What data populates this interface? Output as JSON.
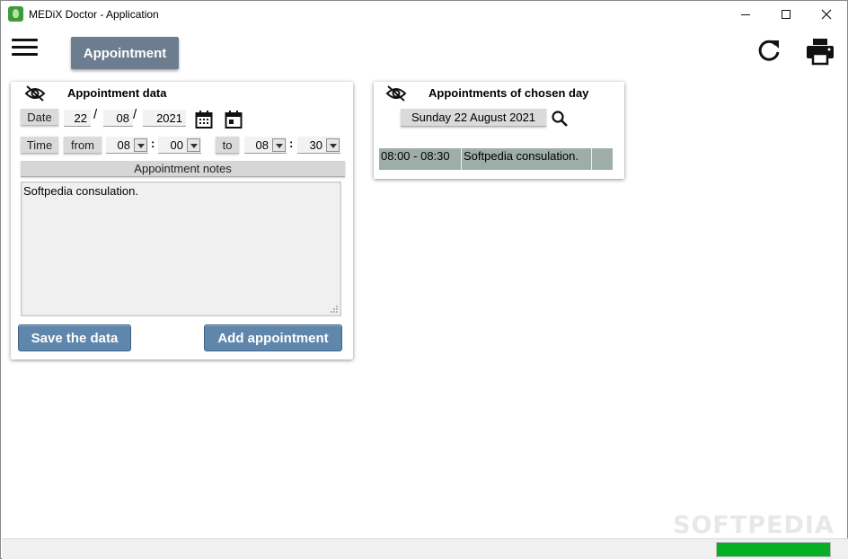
{
  "window": {
    "title": "MEDiX Doctor - Application"
  },
  "toolbar": {
    "tab_label": "Appointment"
  },
  "appointment_data": {
    "title": "Appointment data",
    "date_label": "Date",
    "day": "22",
    "month": "08",
    "year": "2021",
    "date_sep": "/",
    "time_label": "Time",
    "from_label": "from",
    "from_hour": "08",
    "from_minute": "00",
    "time_sep": ":",
    "to_label": "to",
    "to_hour": "08",
    "to_minute": "30",
    "notes_header": "Appointment notes",
    "notes_value": "Softpedia consulation.",
    "save_label": "Save the data",
    "add_label": "Add appointment"
  },
  "chosen_day": {
    "title": "Appointments of chosen day",
    "date_label": "Sunday 22 August 2021",
    "appointments": [
      {
        "time": "08:00 - 08:30",
        "note": "Softpedia consulation."
      }
    ]
  },
  "status": {
    "progress_fraction": 1.0
  },
  "watermark": "SOFTPEDIA",
  "colors": {
    "accent": "#6b7d8e",
    "button": "#5f86ab",
    "progress": "#06b025",
    "row": "#9eacaa"
  },
  "icons": [
    "app-icon",
    "minimize-icon",
    "maximize-icon",
    "close-icon",
    "hamburger-icon",
    "refresh-icon",
    "print-icon",
    "eye-off-icon",
    "calendar-icon",
    "calendar-today-icon",
    "search-icon",
    "chevron-down-icon",
    "resize-grip-icon"
  ]
}
